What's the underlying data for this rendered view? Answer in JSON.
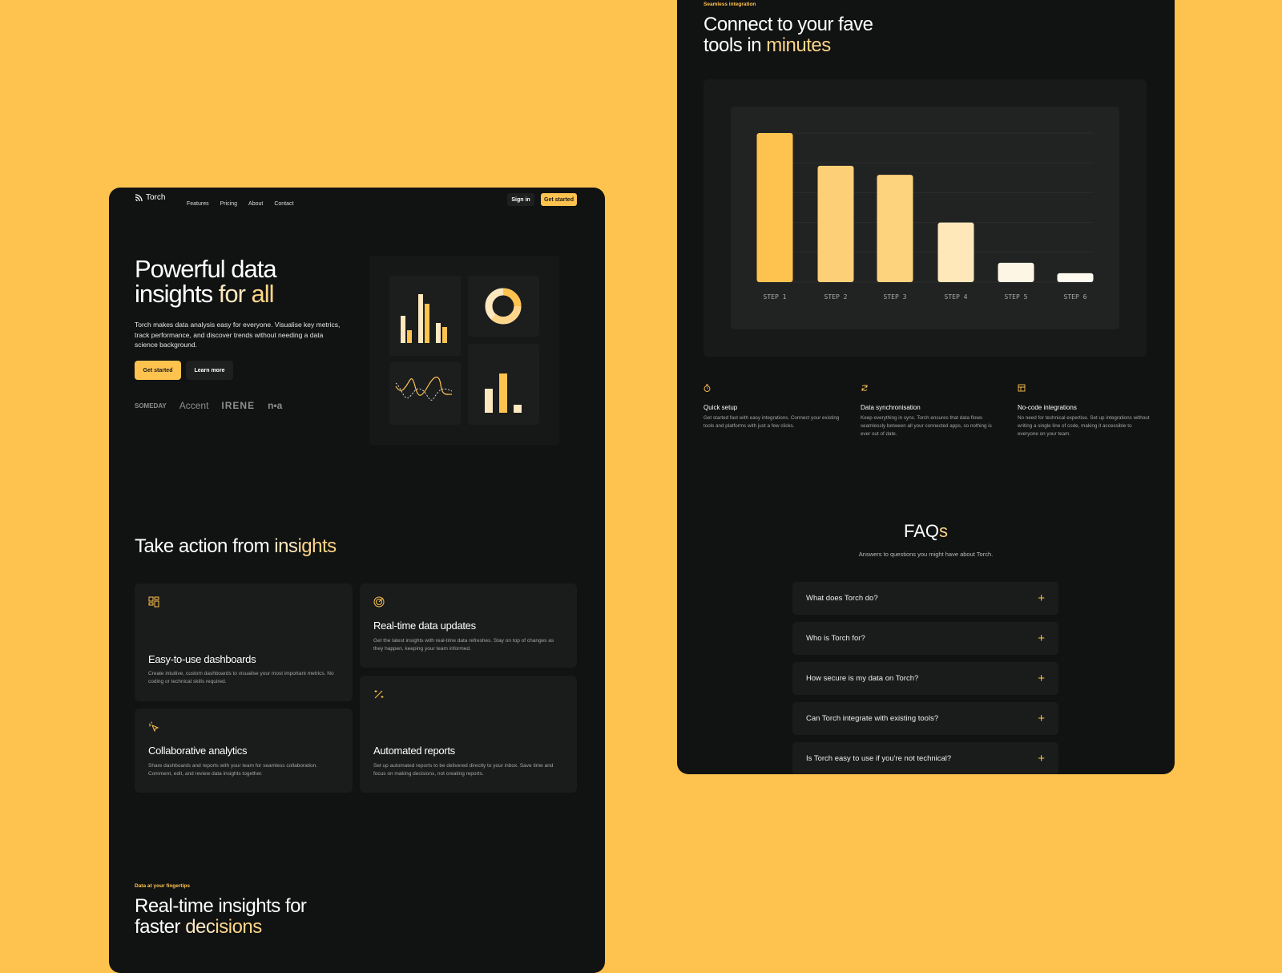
{
  "colors": {
    "background": "#FEC34F",
    "panel": "#111212",
    "card": "#1a1b1b",
    "accent": "#FEC34F",
    "cream": "#FCE7BE"
  },
  "left": {
    "nav": {
      "logo": "Torch",
      "logo_icon": "signal-icon",
      "links": [
        "Features",
        "Pricing",
        "About",
        "Contact"
      ],
      "sign_in": "Sign in",
      "get_started": "Get started"
    },
    "hero": {
      "title_line1": "Powerful data",
      "title_line2_white": "insights ",
      "title_line2_cream": "for ",
      "title_line2_yellow": "all",
      "description": "Torch makes data analysis easy for everyone. Visualise key metrics, track performance, and discover trends without needing a data science background.",
      "primary_button": "Get started",
      "secondary_button": "Learn more",
      "logos": [
        "SOMEDAY",
        "Accent",
        "IRENE",
        "n•a"
      ]
    },
    "section": {
      "title_white": "Take action from ",
      "title_cream": "ins",
      "title_yellow": "ights"
    },
    "features": [
      {
        "icon": "dashboard-icon",
        "title": "Easy-to-use dashboards",
        "description": "Create intuitive, custom dashboards to visualise your most important metrics. No coding or technical skills required."
      },
      {
        "icon": "radar-icon",
        "title": "Real-time data updates",
        "description": "Get the latest insights with real-time data refreshes. Stay on top of changes as they happen, keeping your team informed."
      },
      {
        "icon": "cursor-click-icon",
        "title": "Collaborative analytics",
        "description": "Share dashboards and reports with your team for seamless collaboration. Comment, edit, and review data insights together."
      },
      {
        "icon": "magic-wand-icon",
        "title": "Automated reports",
        "description": "Set up automated reports to be delivered directly to your inbox. Save time and focus on making decisions, not creating reports."
      }
    ],
    "bottom": {
      "eyebrow": "Data at your fingertips",
      "title_line1": "Real-time insights for",
      "title_line2_white": "faster ",
      "title_line2_cream": "dec",
      "title_line2_yellow": "isions"
    }
  },
  "right": {
    "eyebrow": "Seamless integration",
    "title_line1": "Connect to your fave",
    "title_line2_white": "tools in ",
    "title_line2_cream": "minutes",
    "features": [
      {
        "icon": "stopwatch-icon",
        "title": "Quick setup",
        "description": "Get started fast with easy integrations. Connect your existing tools and platforms with just a few clicks."
      },
      {
        "icon": "sync-icon",
        "title": "Data synchronisation",
        "description": "Keep everything in sync. Torch ensures that data flows seamlessly between all your connected apps, so nothing is ever out of date."
      },
      {
        "icon": "layout-icon",
        "title": "No-code integrations",
        "description": "No need for technical expertise. Set up integrations without writing a single line of code, making it accessible to everyone on your team."
      }
    ],
    "faq": {
      "title_white": "FAQ",
      "title_yellow": "s",
      "subtitle": "Answers to questions you might have about Torch.",
      "items": [
        "What does Torch do?",
        "Who is Torch for?",
        "How secure is my data on Torch?",
        "Can Torch integrate with existing tools?",
        "Is Torch easy to use if you're not technical?"
      ]
    }
  },
  "chart_data": {
    "type": "bar",
    "categories": [
      "STEP 1",
      "STEP 2",
      "STEP 3",
      "STEP 4",
      "STEP 5",
      "STEP 6"
    ],
    "values": [
      100,
      78,
      72,
      40,
      13,
      6
    ],
    "ylim": [
      0,
      100
    ],
    "grid": true,
    "xlabel": "",
    "ylabel": "",
    "bar_colors": [
      "#FEC34F",
      "#FDD077",
      "#FDD37E",
      "#FEE8BA",
      "#FEF6E4",
      "#FEFAF0"
    ]
  }
}
